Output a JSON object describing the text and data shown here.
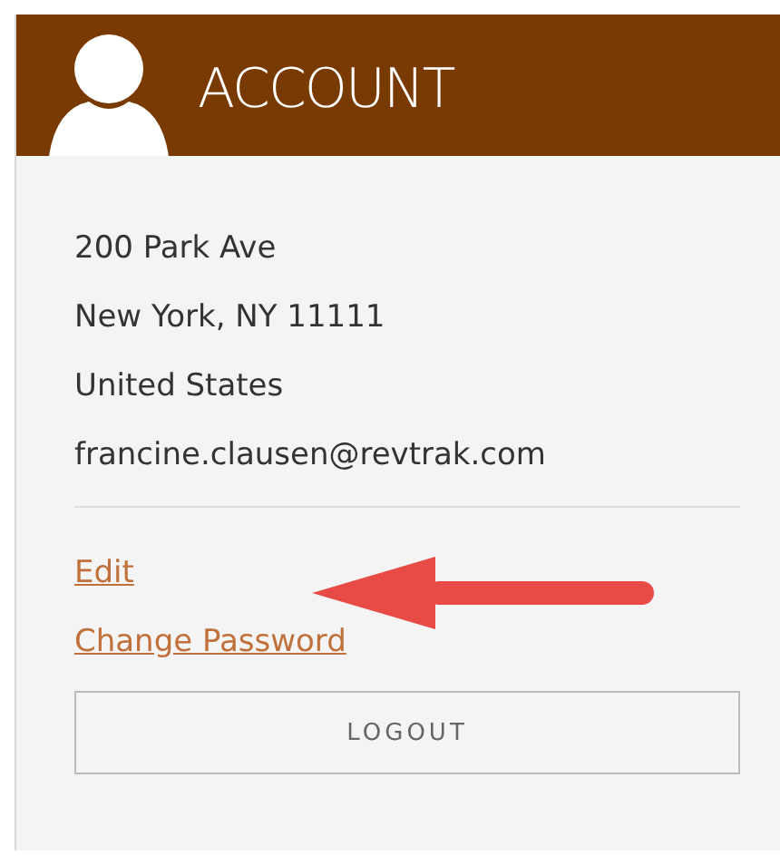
{
  "header": {
    "title": "ACCOUNT"
  },
  "address_lines": [
    "200 Park Ave",
    "New York, NY 11111",
    "United States",
    "francine.clausen@revtrak.com"
  ],
  "links": [
    "Edit",
    "Change Password"
  ],
  "buttons": [
    "LOGOUT"
  ]
}
